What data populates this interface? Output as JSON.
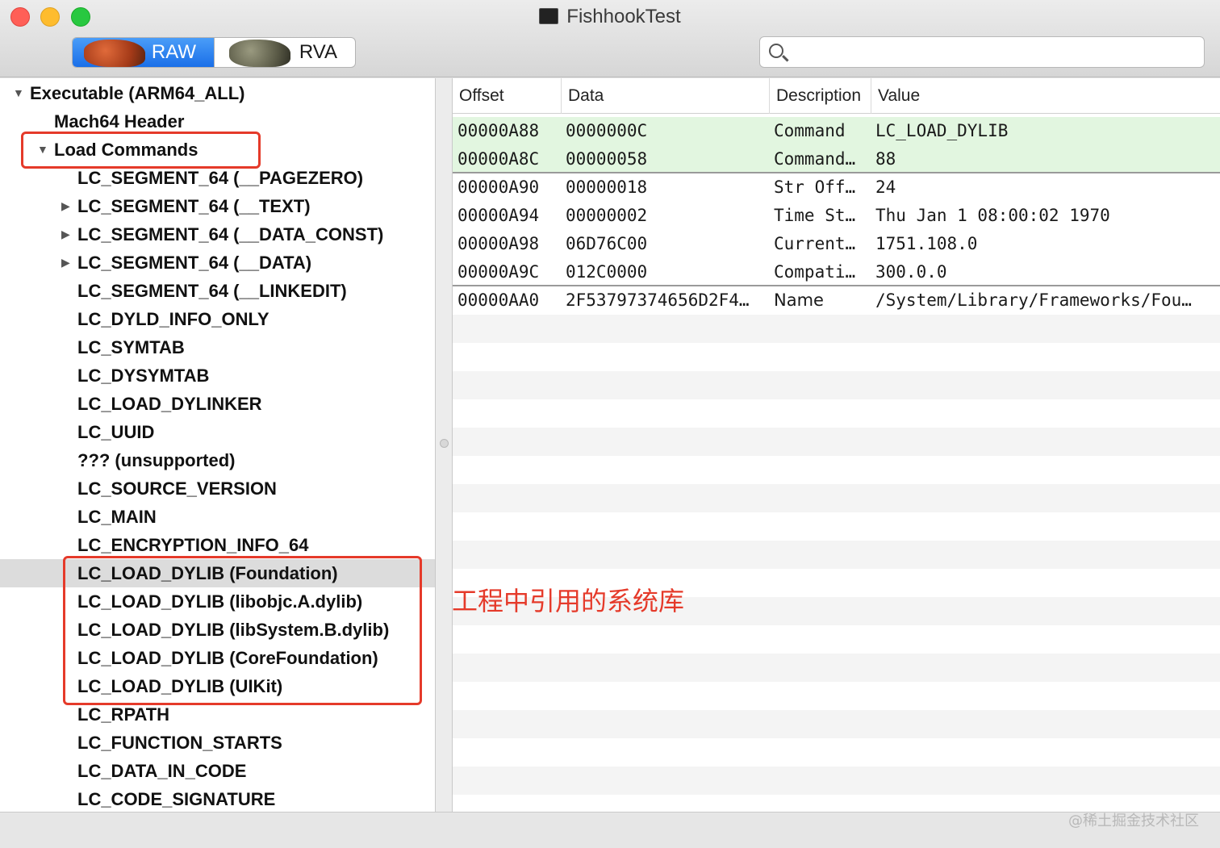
{
  "window": {
    "title": "FishhookTest"
  },
  "toolbar": {
    "segments": [
      {
        "label": "RAW",
        "active": true
      },
      {
        "label": "RVA",
        "active": false
      }
    ],
    "search": {
      "placeholder": "",
      "value": ""
    }
  },
  "tree": [
    {
      "label": "Executable  (ARM64_ALL)",
      "level": 0,
      "disclosure": "open"
    },
    {
      "label": "Mach64 Header",
      "level": 1,
      "disclosure": "none"
    },
    {
      "label": "Load Commands",
      "level": 1,
      "disclosure": "open"
    },
    {
      "label": "LC_SEGMENT_64 (__PAGEZERO)",
      "level": 2,
      "disclosure": "none"
    },
    {
      "label": "LC_SEGMENT_64 (__TEXT)",
      "level": 2,
      "disclosure": "closed"
    },
    {
      "label": "LC_SEGMENT_64 (__DATA_CONST)",
      "level": 2,
      "disclosure": "closed"
    },
    {
      "label": "LC_SEGMENT_64 (__DATA)",
      "level": 2,
      "disclosure": "closed"
    },
    {
      "label": "LC_SEGMENT_64 (__LINKEDIT)",
      "level": 2,
      "disclosure": "none"
    },
    {
      "label": "LC_DYLD_INFO_ONLY",
      "level": 2,
      "disclosure": "none"
    },
    {
      "label": "LC_SYMTAB",
      "level": 2,
      "disclosure": "none"
    },
    {
      "label": "LC_DYSYMTAB",
      "level": 2,
      "disclosure": "none"
    },
    {
      "label": "LC_LOAD_DYLINKER",
      "level": 2,
      "disclosure": "none"
    },
    {
      "label": "LC_UUID",
      "level": 2,
      "disclosure": "none"
    },
    {
      "label": "??? (unsupported)",
      "level": 2,
      "disclosure": "none"
    },
    {
      "label": "LC_SOURCE_VERSION",
      "level": 2,
      "disclosure": "none"
    },
    {
      "label": "LC_MAIN",
      "level": 2,
      "disclosure": "none"
    },
    {
      "label": "LC_ENCRYPTION_INFO_64",
      "level": 2,
      "disclosure": "none"
    },
    {
      "label": "LC_LOAD_DYLIB (Foundation)",
      "level": 2,
      "disclosure": "none",
      "selected": true
    },
    {
      "label": "LC_LOAD_DYLIB (libobjc.A.dylib)",
      "level": 2,
      "disclosure": "none"
    },
    {
      "label": "LC_LOAD_DYLIB (libSystem.B.dylib)",
      "level": 2,
      "disclosure": "none"
    },
    {
      "label": "LC_LOAD_DYLIB (CoreFoundation)",
      "level": 2,
      "disclosure": "none"
    },
    {
      "label": "LC_LOAD_DYLIB (UIKit)",
      "level": 2,
      "disclosure": "none"
    },
    {
      "label": "LC_RPATH",
      "level": 2,
      "disclosure": "none"
    },
    {
      "label": "LC_FUNCTION_STARTS",
      "level": 2,
      "disclosure": "none"
    },
    {
      "label": "LC_DATA_IN_CODE",
      "level": 2,
      "disclosure": "none"
    },
    {
      "label": "LC_CODE_SIGNATURE",
      "level": 2,
      "disclosure": "none"
    }
  ],
  "table": {
    "columns": [
      "Offset",
      "Data",
      "Description",
      "Value"
    ],
    "rows": [
      {
        "offset": "00000A88",
        "data": "0000000C",
        "description": "Command",
        "value": "LC_LOAD_DYLIB",
        "highlight": true
      },
      {
        "offset": "00000A8C",
        "data": "00000058",
        "description": "Command…",
        "value": "88",
        "highlight": true,
        "separator": true
      },
      {
        "offset": "00000A90",
        "data": "00000018",
        "description": "Str Off…",
        "value": "24"
      },
      {
        "offset": "00000A94",
        "data": "00000002",
        "description": "Time St…",
        "value": "Thu Jan  1 08:00:02 1970"
      },
      {
        "offset": "00000A98",
        "data": "06D76C00",
        "description": "Current…",
        "value": "1751.108.0"
      },
      {
        "offset": "00000A9C",
        "data": "012C0000",
        "description": "Compati…",
        "value": "300.0.0",
        "separator": true
      },
      {
        "offset": "00000AA0",
        "data": "2F53797374656D2F4…",
        "description": "Name",
        "value": "/System/Library/Frameworks/Fou…",
        "sansDescription": true
      }
    ]
  },
  "annotation": {
    "text": "工程中引用的系统库",
    "color": "#e53a2a"
  },
  "watermark": "@稀土掘金技术社区",
  "colors": {
    "highlight_row": "#e2f6e0",
    "annotation_red": "#e53a2a",
    "segment_active": "#1a6fe8"
  }
}
